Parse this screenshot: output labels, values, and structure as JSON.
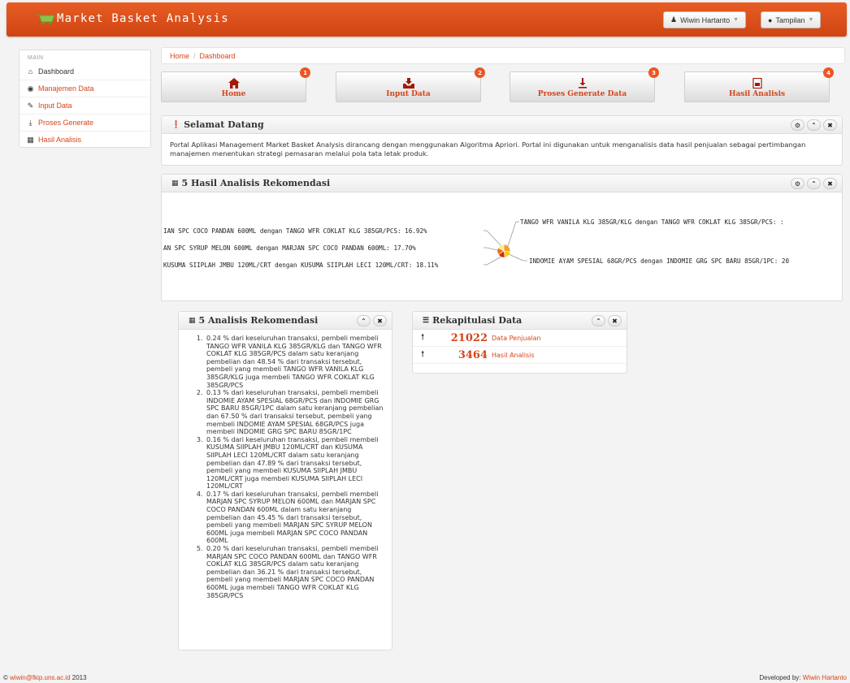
{
  "navbar": {
    "brand": "Market Basket Analysis",
    "user_button": "Wiwin Hartanto",
    "view_button": "Tampilan"
  },
  "sidebar": {
    "header": "MAIN",
    "items": [
      {
        "label": "Dashboard",
        "icon": "home-icon"
      },
      {
        "label": "Manajemen Data",
        "icon": "eye-icon"
      },
      {
        "label": "Input Data",
        "icon": "edit-icon"
      },
      {
        "label": "Proses Generate",
        "icon": "download-icon"
      },
      {
        "label": "Hasil Analisis",
        "icon": "table-icon"
      }
    ]
  },
  "breadcrumb": {
    "home": "Home",
    "separator": "/",
    "current": "Dashboard"
  },
  "quick_buttons": [
    {
      "label": "Home",
      "badge": "1",
      "icon": "home-icon"
    },
    {
      "label": "Input Data",
      "badge": "2",
      "icon": "inbox-icon"
    },
    {
      "label": "Proses Generate Data",
      "badge": "3",
      "icon": "download-icon"
    },
    {
      "label": "Hasil Analisis",
      "badge": "4",
      "icon": "document-icon"
    }
  ],
  "welcome": {
    "title": "Selamat Datang",
    "text": "Portal Aplikasi Management Market Basket Analysis dirancang dengan menggunakan Algoritma Apriori. Portal ini digunakan untuk menganalisis data hasil penjualan sebagai pertimbangan manajemen menentukan strategi pemasaran melalui pola tata letak produk."
  },
  "chart_box": {
    "title": "5 Hasil Analisis Rekomendasi"
  },
  "chart_data": {
    "type": "pie",
    "labels": [
      "TANGO WFR VANILA KLG 385GR/KLG dengan TANGO WFR COKLAT KLG 385GR/PCS",
      "INDOMIE AYAM SPESIAL 68GR/PCS dengan INDOMIE GRG SPC BARU 85GR/1PC",
      "KUSUMA SIIPLAH JMBU 120ML/CRT dengan KUSUMA SIIPLAH LECI 120ML/CRT",
      "MARJAN SPC SYRUP MELON 600ML dengan MARJAN SPC COCO PANDAN 600ML",
      "MARJAN SPC COCO PANDAN 600ML dengan TANGO WFR COKLAT KLG 385GR/PCS"
    ],
    "display_labels": [
      "TANGO WFR VANILA KLG 385GR/KLG dengan TANGO WFR COKLAT KLG 385GR/PCS: :",
      "INDOMIE AYAM SPESIAL 68GR/PCS dengan INDOMIE GRG SPC BARU 85GR/1PC: 20",
      "KUSUMA SIIPLAH JMBU 120ML/CRT dengan KUSUMA SIIPLAH LECI 120ML/CRT: 18.11%",
      "AN SPC SYRUP MELON 600ML dengan MARJAN SPC COCO PANDAN 600ML: 17.70%",
      "IAN SPC COCO PANDAN 600ML dengan TANGO WFR COKLAT KLG 385GR/PCS: 16.92%"
    ],
    "values": [
      26.6,
      20.67,
      18.11,
      17.7,
      16.92
    ],
    "colors": [
      "#f0a030",
      "#f5d000",
      "#e02020",
      "#e87010",
      "#ffee80"
    ]
  },
  "recommendations": {
    "title": "5 Analisis Rekomendasi",
    "items": [
      "0.24 % dari keseluruhan transaksi, pembeli membeli TANGO WFR VANILA KLG 385GR/KLG dan TANGO WFR COKLAT KLG 385GR/PCS dalam satu keranjang pembelian dan 48.54 % dari transaksi tersebut, pembeli yang membeli TANGO WFR VANILA KLG 385GR/KLG juga membeli TANGO WFR COKLAT KLG 385GR/PCS",
      "0.13 % dari keseluruhan transaksi, pembeli membeli INDOMIE AYAM SPESIAL 68GR/PCS dan INDOMIE GRG SPC BARU 85GR/1PC dalam satu keranjang pembelian dan 67.50 % dari transaksi tersebut, pembeli yang membeli INDOMIE AYAM SPESIAL 68GR/PCS juga membeli INDOMIE GRG SPC BARU 85GR/1PC",
      "0.16 % dari keseluruhan transaksi, pembeli membeli KUSUMA SIIPLAH JMBU 120ML/CRT dan KUSUMA SIIPLAH LECI 120ML/CRT dalam satu keranjang pembelian dan 47.89 % dari transaksi tersebut, pembeli yang membeli KUSUMA SIIPLAH JMBU 120ML/CRT juga membeli KUSUMA SIIPLAH LECI 120ML/CRT",
      "0.17 % dari keseluruhan transaksi, pembeli membeli MARJAN SPC SYRUP MELON 600ML dan MARJAN SPC COCO PANDAN 600ML dalam satu keranjang pembelian dan 45.45 % dari transaksi tersebut, pembeli yang membeli MARJAN SPC SYRUP MELON 600ML juga membeli MARJAN SPC COCO PANDAN 600ML",
      "0.20 % dari keseluruhan transaksi, pembeli membeli MARJAN SPC COCO PANDAN 600ML dan TANGO WFR COKLAT KLG 385GR/PCS dalam satu keranjang pembelian dan 36.21 % dari transaksi tersebut, pembeli yang membeli MARJAN SPC COCO PANDAN 600ML juga membeli TANGO WFR COKLAT KLG 385GR/PCS"
    ]
  },
  "recap": {
    "title": "Rekapitulasi Data",
    "rows": [
      {
        "value": "21022",
        "label": "Data Penjualan"
      },
      {
        "value": "3464",
        "label": "Hasil Analisis"
      }
    ]
  },
  "footer": {
    "left_prefix": "©",
    "email": "wiwin@fkip.uns.ac.id",
    "year": "2013",
    "right_prefix": "Developed by:",
    "author": "Wiwin Hartanto"
  },
  "colors": {
    "brand": "#e05520",
    "accent": "#d5451a"
  }
}
